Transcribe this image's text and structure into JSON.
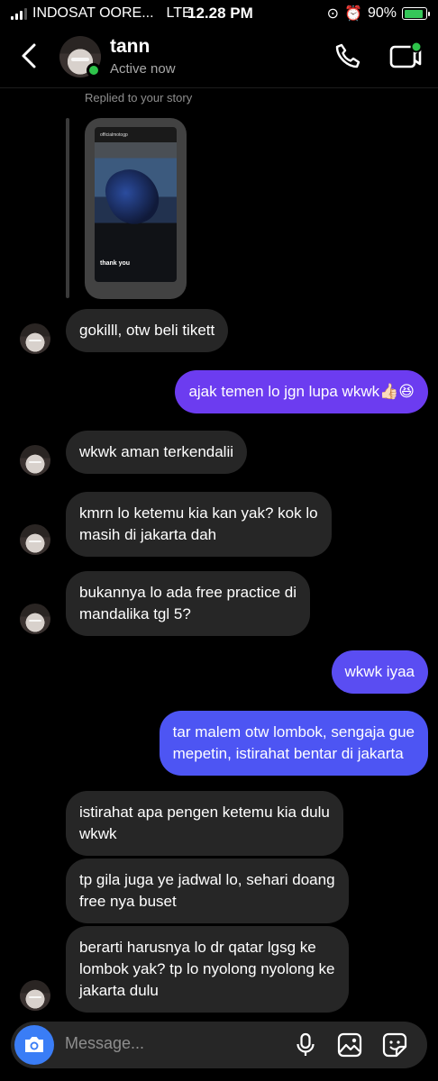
{
  "status_bar": {
    "carrier": "INDOSAT OORE...",
    "network": "LTE",
    "time": "12.28 PM",
    "battery": "90%"
  },
  "header": {
    "name": "tann",
    "status": "Active now"
  },
  "story_reply": {
    "label": "Replied to your story",
    "story_tag": "officialmotogp",
    "caption": "thank you"
  },
  "messages": [
    {
      "side": "in",
      "lines": [
        "gokilll, otw beli tikett"
      ]
    },
    {
      "side": "out",
      "lines": [
        "ajak temen lo jgn lupa wkwk👍🏻😆"
      ]
    },
    {
      "side": "in",
      "lines": [
        "wkwk aman terkendalii"
      ]
    },
    {
      "side": "in",
      "lines": [
        "kmrn lo ketemu kia kan yak? kok lo",
        "masih di jakarta dah"
      ]
    },
    {
      "side": "in",
      "lines": [
        "bukannya lo ada free practice di",
        "mandalika tgl 5?"
      ]
    },
    {
      "side": "out",
      "lines": [
        "wkwk iyaa"
      ]
    },
    {
      "side": "out",
      "lines": [
        "tar malem otw lombok, sengaja gue",
        "mepetin, istirahat bentar di jakarta"
      ]
    },
    {
      "side": "in",
      "lines": [
        "istirahat apa pengen ketemu kia dulu",
        "wkwk"
      ]
    },
    {
      "side": "in",
      "lines": [
        "tp gila juga ye jadwal lo, sehari doang",
        "free nya buset"
      ]
    },
    {
      "side": "in",
      "lines": [
        "berarti harusnya lo dr qatar lgsg ke",
        "lombok yak? tp lo nyolong nyolong ke",
        "jakarta dulu"
      ]
    }
  ],
  "composer": {
    "placeholder": "Message..."
  },
  "colors": {
    "incoming": "#262626",
    "outgoing_top": "#6c3cf0",
    "outgoing_bottom": "#4d55f3",
    "accent": "#3a7df6",
    "online": "#2ec34a"
  },
  "icons": [
    "back-chevron-icon",
    "phone-icon",
    "video-call-icon",
    "camera-icon",
    "microphone-icon",
    "gallery-icon",
    "sticker-icon"
  ]
}
